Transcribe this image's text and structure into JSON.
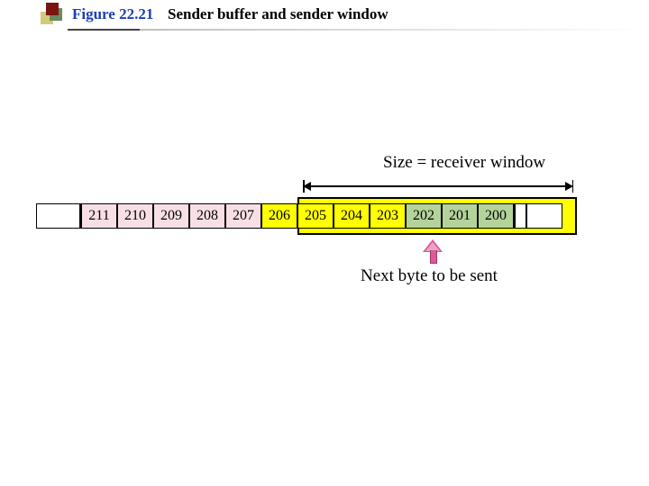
{
  "header": {
    "figure_number": "Figure 22.21",
    "figure_title": "Sender buffer and sender window"
  },
  "diagram": {
    "size_label": "Size = receiver window",
    "next_label": "Next byte to be sent",
    "cells": {
      "c0": "211",
      "c1": "210",
      "c2": "209",
      "c3": "208",
      "c4": "207",
      "c5": "206",
      "c6": "205",
      "c7": "204",
      "c8": "203",
      "c9": "202",
      "c10": "201",
      "c11": "200"
    }
  },
  "chart_data": {
    "type": "table",
    "title": "Sender buffer and sender window",
    "buffer_sequence": [
      211,
      210,
      209,
      208,
      207,
      206,
      205,
      204,
      203,
      202,
      201,
      200
    ],
    "sent_not_acked": [
      211,
      210,
      209,
      208,
      207
    ],
    "sender_window": [
      206,
      205,
      204,
      203,
      202,
      201,
      200
    ],
    "already_acked_or_sent": [
      202,
      201,
      200
    ],
    "next_byte_to_send": 203,
    "window_size_label": "receiver window",
    "window_size": 7
  }
}
